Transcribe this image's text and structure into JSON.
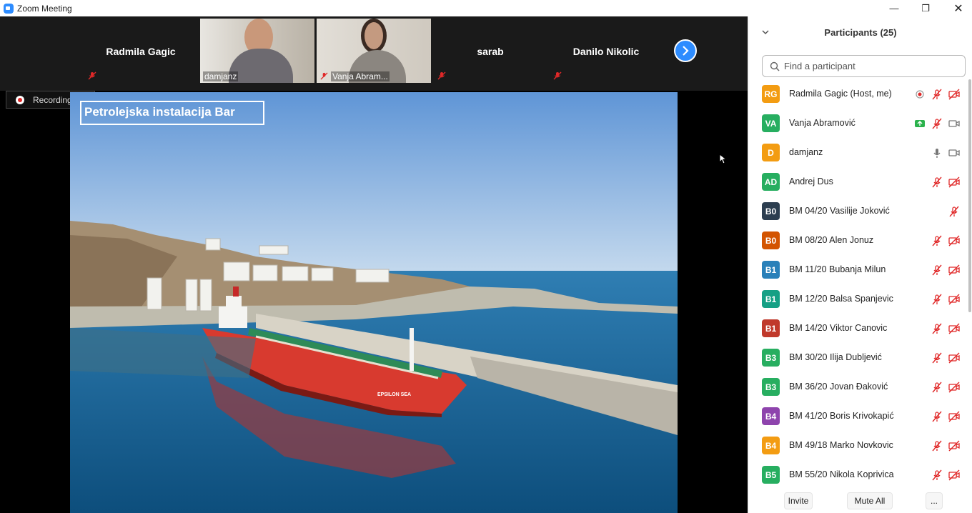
{
  "window": {
    "title": "Zoom Meeting",
    "minimize": "—",
    "maximize": "❐",
    "close": "✕"
  },
  "strip": {
    "tiles": [
      {
        "name": "Radmila Gagic",
        "has_video": false,
        "muted": true
      },
      {
        "name": "damjanz",
        "has_video": true,
        "muted": false,
        "active": true
      },
      {
        "name": "Vanja Abram...",
        "has_video": true,
        "muted": true
      },
      {
        "name": "sarab",
        "has_video": false,
        "muted": true
      },
      {
        "name": "Danilo Nikolic",
        "has_video": false,
        "muted": true
      }
    ]
  },
  "recording": {
    "label": "Recording..."
  },
  "slide": {
    "title": "Petrolejska instalacija Bar",
    "ship_name": "EPSILON SEA"
  },
  "panel": {
    "title": "Participants (25)",
    "search_placeholder": "Find a participant",
    "participants": [
      {
        "initials": "RG",
        "name": "Radmila Gagic (Host, me)",
        "color": "#f39c12",
        "mic": "muted",
        "video": "off",
        "extra": "recording"
      },
      {
        "initials": "VA",
        "name": "Vanja Abramović",
        "color": "#27ae60",
        "mic": "muted",
        "video": "on",
        "extra": "share"
      },
      {
        "initials": "D",
        "name": "damjanz",
        "color": "#f39c12",
        "mic": "on",
        "video": "on",
        "extra": ""
      },
      {
        "initials": "AD",
        "name": "Andrej Dus",
        "color": "#27ae60",
        "mic": "muted",
        "video": "off",
        "extra": ""
      },
      {
        "initials": "B0",
        "name": "BM 04/20 Vasilije Joković",
        "color": "#2c3e50",
        "mic": "none",
        "video": "mic-muted-only",
        "extra": ""
      },
      {
        "initials": "B0",
        "name": "BM 08/20 Alen Jonuz",
        "color": "#d35400",
        "mic": "muted",
        "video": "off",
        "extra": ""
      },
      {
        "initials": "B1",
        "name": "BM 11/20 Bubanja Milun",
        "color": "#2980b9",
        "mic": "muted",
        "video": "off",
        "extra": ""
      },
      {
        "initials": "B1",
        "name": "BM 12/20 Balsa Spanjevic",
        "color": "#16a085",
        "mic": "muted",
        "video": "off",
        "extra": ""
      },
      {
        "initials": "B1",
        "name": "BM 14/20 Viktor Canovic",
        "color": "#c0392b",
        "mic": "muted",
        "video": "off",
        "extra": ""
      },
      {
        "initials": "B3",
        "name": "BM 30/20 Ilija Dubljević",
        "color": "#27ae60",
        "mic": "muted",
        "video": "off",
        "extra": ""
      },
      {
        "initials": "B3",
        "name": "BM 36/20 Jovan Đaković",
        "color": "#27ae60",
        "mic": "muted",
        "video": "off",
        "extra": ""
      },
      {
        "initials": "B4",
        "name": "BM 41/20 Boris Krivokapić",
        "color": "#8e44ad",
        "mic": "muted",
        "video": "off",
        "extra": ""
      },
      {
        "initials": "B4",
        "name": "BM 49/18 Marko Novkovic",
        "color": "#f39c12",
        "mic": "muted",
        "video": "off",
        "extra": ""
      },
      {
        "initials": "B5",
        "name": "BM 55/20 Nikola Koprivica",
        "color": "#27ae60",
        "mic": "muted",
        "video": "off",
        "extra": ""
      }
    ],
    "footer": {
      "invite": "Invite",
      "mute_all": "Mute All",
      "more": "..."
    }
  }
}
